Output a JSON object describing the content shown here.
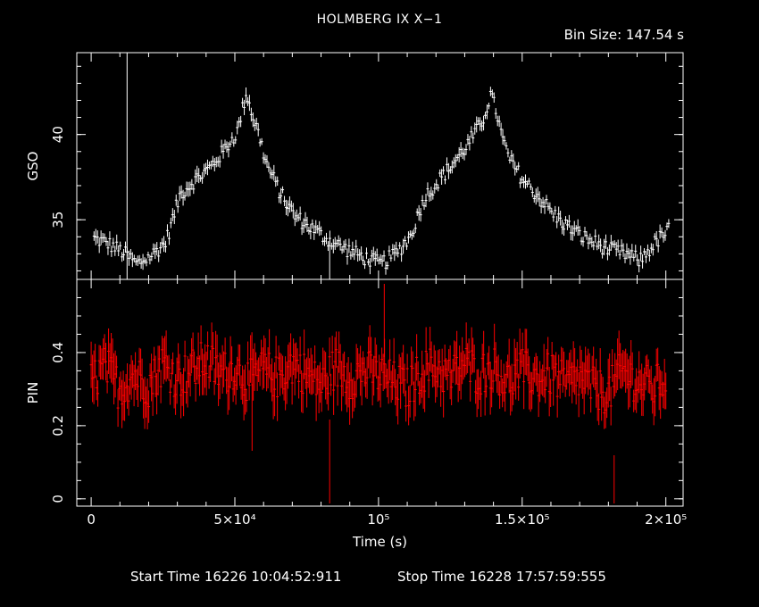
{
  "title": "HOLMBERG IX X−1",
  "bin_size_text": "Bin Size: 147.54 s",
  "footer": {
    "start_text": "Start Time 16226 10:04:52:911",
    "stop_text": "Stop Time 16228 17:57:59:555"
  },
  "colors": {
    "background": "#000000",
    "axes": "#ffffff",
    "gso_series": "#ffffff",
    "pin_series": "#ff0000"
  },
  "chart_data": [
    {
      "type": "scatter",
      "panel": "top",
      "ylabel": "GSO",
      "xlim": [
        -5000,
        206000
      ],
      "ylim": [
        31.5,
        44.8
      ],
      "yticks": [
        35,
        40
      ],
      "ytick_labels": [
        "35",
        "40"
      ],
      "error_bars": true,
      "series": [
        {
          "x": [
            1000,
            6000,
            11000,
            16000,
            21000,
            26000,
            31000,
            36000,
            41000,
            46000,
            51000,
            54000,
            56000,
            58000,
            61000,
            66000,
            71000,
            76000,
            81000,
            86000,
            91000,
            96000,
            101000,
            106000,
            111000,
            116000,
            121000,
            126000,
            131000,
            136000,
            139000,
            141000,
            143000,
            146000,
            151000,
            156000,
            161000,
            166000,
            171000,
            176000,
            181000,
            186000,
            191000,
            196000,
            201000
          ],
          "y": [
            33.9,
            33.6,
            33.1,
            32.4,
            32.9,
            33.7,
            36.5,
            37.3,
            38.0,
            39.0,
            40.2,
            42.5,
            41.2,
            40.2,
            38.3,
            36.5,
            35.2,
            34.6,
            34.0,
            33.5,
            33.1,
            32.7,
            32.4,
            33.0,
            34.0,
            36.3,
            37.3,
            38.3,
            39.4,
            40.7,
            42.3,
            41.4,
            39.8,
            38.4,
            37.2,
            36.3,
            35.3,
            34.6,
            34.0,
            33.6,
            33.2,
            33.0,
            32.6,
            33.6,
            34.4
          ]
        }
      ]
    },
    {
      "type": "scatter",
      "panel": "bottom",
      "ylabel": "PIN",
      "xlabel": "Time (s)",
      "xlim": [
        -5000,
        206000
      ],
      "ylim": [
        -0.02,
        0.6
      ],
      "yticks": [
        0,
        0.2,
        0.4
      ],
      "ytick_labels": [
        "0",
        "0.2",
        "0.4"
      ],
      "xticks": [
        0,
        50000,
        100000,
        150000,
        200000
      ],
      "xtick_labels": [
        "0",
        "5×10⁴",
        "10⁵",
        "1.5×10⁵",
        "2×10⁵"
      ],
      "error_bars": true,
      "series": [
        {
          "x": [
            0,
            5000,
            10000,
            15000,
            20000,
            25000,
            30000,
            35000,
            40000,
            45000,
            50000,
            55000,
            60000,
            65000,
            70000,
            75000,
            80000,
            85000,
            90000,
            95000,
            100000,
            105000,
            110000,
            115000,
            120000,
            125000,
            130000,
            135000,
            140000,
            145000,
            150000,
            155000,
            160000,
            165000,
            170000,
            175000,
            180000,
            185000,
            190000,
            195000,
            200000
          ],
          "y": [
            0.32,
            0.36,
            0.3,
            0.34,
            0.31,
            0.37,
            0.33,
            0.35,
            0.38,
            0.34,
            0.36,
            0.32,
            0.35,
            0.33,
            0.37,
            0.34,
            0.31,
            0.36,
            0.33,
            0.35,
            0.34,
            0.32,
            0.3,
            0.35,
            0.36,
            0.33,
            0.37,
            0.34,
            0.36,
            0.32,
            0.35,
            0.33,
            0.34,
            0.31,
            0.33,
            0.3,
            0.29,
            0.35,
            0.32,
            0.3,
            0.33
          ]
        }
      ]
    }
  ]
}
